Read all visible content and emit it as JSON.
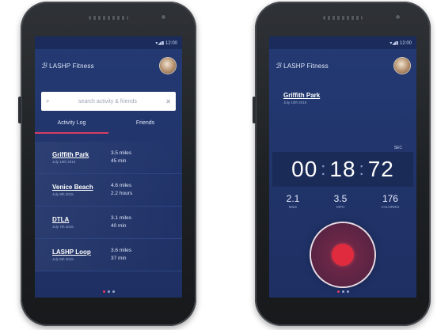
{
  "left_screen": {
    "app_title": "LASHP Fitness",
    "logo_glyph": "ℬ",
    "status_icons": "▾◢▮ 12:00",
    "search_placeholder": "search activity & friends",
    "tabs": [
      {
        "label": "Activity Log",
        "active": true
      },
      {
        "label": "Friends",
        "active": false
      }
    ],
    "activities": [
      {
        "place": "Griffith Park",
        "date": "July 10th 2015",
        "distance": "3.5 miles",
        "duration": "45 min"
      },
      {
        "place": "Venice Beach",
        "date": "July 9th 2015",
        "distance": "4.6 miles",
        "duration": "2.2 hours"
      },
      {
        "place": "DTLA",
        "date": "July 7th 2015",
        "distance": "3.1 miles",
        "duration": "40 min"
      },
      {
        "place": "LASHP Loop",
        "date": "July 5th 2015",
        "distance": "3.6 miles",
        "duration": "37 min"
      }
    ]
  },
  "right_screen": {
    "app_title": "LASHP Fitness",
    "logo_glyph": "ℬ",
    "status_icons": "▾◢▮ 12:00",
    "run_place": "Griffith Park",
    "run_date": "July 10th 2015",
    "seconds_label": "SEC",
    "timer": {
      "hours": "00",
      "minutes": "18",
      "seconds": "72"
    },
    "stats": [
      {
        "value": "2.1",
        "label": "MILE"
      },
      {
        "value": "3.5",
        "label": "MPH"
      },
      {
        "value": "176",
        "label": "CALORIES"
      }
    ]
  },
  "colors": {
    "screen_bg": "#243a73",
    "accent": "#d93c63",
    "record": "#e02a3e"
  }
}
